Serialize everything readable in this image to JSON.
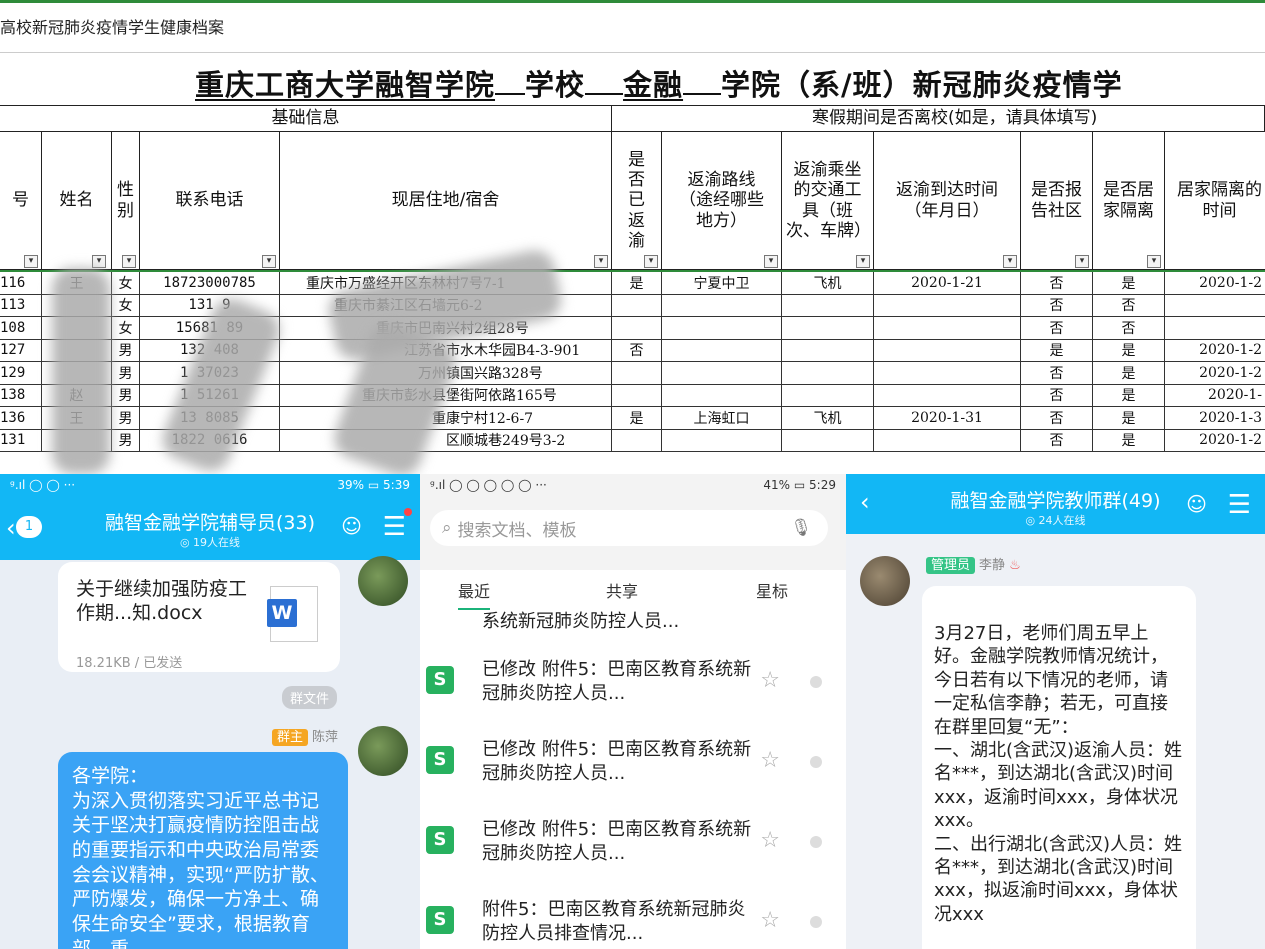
{
  "sheet": {
    "doc_title": "高校新冠肺炎疫情学生健康档案",
    "main_title": {
      "school": "重庆工商大学融智学院",
      "school_suffix": "学校",
      "dept": "金融",
      "dept_suffix": "学院（系/班）新冠肺炎疫情学"
    },
    "group_headers": [
      "基础信息",
      "寒假期间是否离校(如是，请具体填写)"
    ],
    "columns": [
      "号",
      "姓名",
      "性别",
      "联系电话",
      "现居住地/宿舍",
      "是否已返渝",
      "返渝路线（途经哪些地方）",
      "返渝乘坐的交通工具（班次、车牌）",
      "返渝到达时间（年月日）",
      "是否报告社区",
      "是否居家隔离",
      "居家隔离的时间"
    ],
    "rows": [
      [
        "116",
        "王",
        "女",
        "18723000785",
        "重庆市万盛经开区东林",
        "村7号7-1",
        "是",
        "宁夏中卫",
        "飞机",
        "2020-1-21",
        "否",
        "是",
        "2020-1-2"
      ],
      [
        "113",
        "",
        "女",
        "131    9",
        "重庆市綦江区石墙",
        "元6-2",
        "",
        "",
        "",
        "",
        "否",
        "否",
        ""
      ],
      [
        "108",
        "",
        "女",
        "15681  89",
        "重庆市巴南",
        "兴村2组28号",
        "",
        "",
        "",
        "",
        "否",
        "否",
        ""
      ],
      [
        "127",
        "",
        "男",
        "132   408",
        "江苏省",
        "市水木华园B4-3-901",
        "否",
        "",
        "",
        "",
        "是",
        "是",
        "2020-1-2"
      ],
      [
        "129",
        "",
        "男",
        "1   37023",
        "万州",
        "镇国兴路328号",
        "",
        "",
        "",
        "",
        "否",
        "是",
        "2020-1-2"
      ],
      [
        "138",
        "赵",
        "男",
        "1   51261",
        "重庆市彭水县",
        "堡街阿依路165号",
        "",
        "",
        "",
        "",
        "否",
        "是",
        "2020-1-"
      ],
      [
        "136",
        "王",
        "男",
        "13   8085",
        "重",
        "康宁村12-6-7",
        "是",
        "上海虹口",
        "飞机",
        "2020-1-31",
        "否",
        "是",
        "2020-1-3"
      ],
      [
        "131",
        "",
        "男",
        "1822  0616",
        "",
        "区顺城巷249号3-2",
        "",
        "",
        "",
        "",
        "否",
        "是",
        "2020-1-2"
      ]
    ]
  },
  "panel1": {
    "status": {
      "left": "ᵍ.ıl ◯ ◯ ···",
      "right": "39% ▭ 5:39"
    },
    "title": "融智金融学院辅导员(33)",
    "subtitle": "◎ 19人在线",
    "back_badge": "1",
    "file_name": "关于继续加强防疫工作期...知.docx",
    "file_size": "18.21KB / 已发送",
    "file_tag": "群文件",
    "sender_role": "群主",
    "sender_name": "陈萍",
    "message": "各学院：\n为深入贯彻落实习近平总书记关于坚决打赢疫情防控阻击战的重要指示和中央政治局常委会会议精神，实现“严防扩散、严防爆发，确保一方净土、确保生命安全”要求，根据教育部、重"
  },
  "panel2": {
    "status": {
      "left": "ᵍ.ıl ◯ ◯ ◯ ◯ ◯ ···",
      "right": "41% ▭ 5:29"
    },
    "search_placeholder": "搜索文档、模板",
    "tabs": [
      "最近",
      "共享",
      "星标"
    ],
    "items": [
      "系统新冠肺炎防控人员...",
      "已修改 附件5：巴南区教育系统新冠肺炎防控人员...",
      "已修改 附件5：巴南区教育系统新冠肺炎防控人员...",
      "已修改 附件5：巴南区教育系统新冠肺炎防控人员...",
      "附件5：巴南区教育系统新冠肺炎防控人员排查情况..."
    ]
  },
  "panel3": {
    "title": "融智金融学院教师群(49)",
    "subtitle": "◎ 24人在线",
    "admin_role": "管理员",
    "admin_name": "李静",
    "message": "3月27日，老师们周五早上好。金融学院教师情况统计，今日若有以下情况的老师，请一定私信李静；若无，可直接在群里回复“无”：\n一、湖北(含武汉)返渝人员：姓名***，到达湖北(含武汉)时间xxx，返渝时间xxx，身体状况xxx。\n二、出行湖北(含武汉)人员：姓名***，到达湖北(含武汉)时间xxx，拟返渝时间xxx，身体状况xxx"
  },
  "colors": {
    "qq_blue": "#12b7f5",
    "wps_green": "#27b15f",
    "sheet_line": "#2e8b3a"
  }
}
